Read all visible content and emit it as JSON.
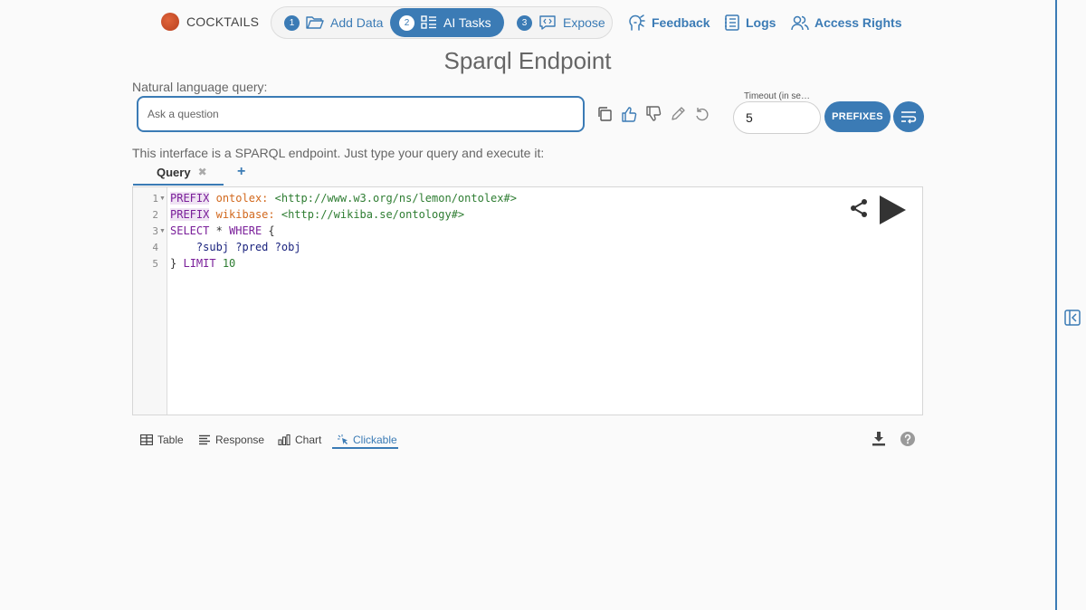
{
  "brand": {
    "name": "COCKTAILS"
  },
  "steps": [
    {
      "num": "1",
      "label": "Add Data",
      "icon": "folder-open-icon",
      "active": false
    },
    {
      "num": "2",
      "label": "AI Tasks",
      "icon": "list-icon",
      "active": true
    },
    {
      "num": "3",
      "label": "Expose",
      "icon": "code-bubble-icon",
      "active": false
    }
  ],
  "nav": {
    "feedback": "Feedback",
    "logs": "Logs",
    "access_rights": "Access Rights"
  },
  "page_title": "Sparql Endpoint",
  "nlq": {
    "label": "Natural language query:",
    "placeholder": "Ask a question"
  },
  "timeout": {
    "label": "Timeout (in se…",
    "value": "5"
  },
  "prefixes_label": "PREFIXES",
  "info_text": "This interface is a SPARQL endpoint. Just type your query and execute it:",
  "query_tab": {
    "label": "Query",
    "close": "✖",
    "add": "+"
  },
  "editor": {
    "line_numbers": [
      "1",
      "2",
      "3",
      "4",
      "5"
    ],
    "lines": {
      "l1": {
        "kw": "PREFIX",
        "prefix": "ontolex:",
        "iri": "<http://www.w3.org/ns/lemon/ontolex#>"
      },
      "l2": {
        "kw": "PREFIX",
        "prefix": "wikibase:",
        "iri": "<http://wikiba.se/ontology#>"
      },
      "l3": {
        "kw1": "SELECT",
        "star": "*",
        "kw2": "WHERE",
        "brace": "{"
      },
      "l4": {
        "v1": "?subj",
        "v2": "?pred",
        "v3": "?obj"
      },
      "l5": {
        "brace": "}",
        "kw": "LIMIT",
        "num": "10"
      }
    }
  },
  "result_tabs": [
    {
      "label": "Table",
      "icon": "table-icon"
    },
    {
      "label": "Response",
      "icon": "lines-icon"
    },
    {
      "label": "Chart",
      "icon": "chart-icon"
    },
    {
      "label": "Clickable",
      "icon": "pointer-icon",
      "active": true
    }
  ],
  "colors": {
    "accent": "#3b7bb5"
  }
}
